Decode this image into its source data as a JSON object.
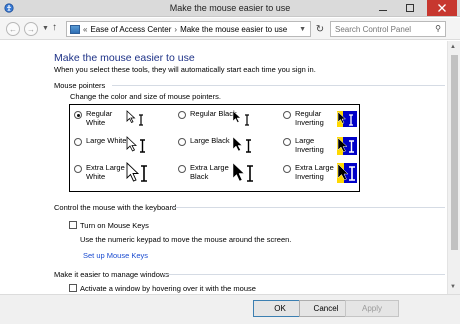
{
  "window": {
    "title": "Make the mouse easier to use"
  },
  "address": {
    "breadcrumbs": [
      "Ease of Access Center",
      "Make the mouse easier to use"
    ],
    "search_placeholder": "Search Control Panel",
    "overflow_glyph": "«"
  },
  "page": {
    "title": "Make the mouse easier to use",
    "description": "When you select these tools, they will automatically start each time you sign in."
  },
  "mouse_pointers": {
    "heading": "Mouse pointers",
    "subheading": "Change the color and size of mouse pointers.",
    "options": [
      {
        "label": "Regular White",
        "style": "white",
        "size": "regular",
        "selected": true
      },
      {
        "label": "Regular Black",
        "style": "black",
        "size": "regular",
        "selected": false
      },
      {
        "label": "Regular Inverting",
        "style": "inverting",
        "size": "regular",
        "selected": false
      },
      {
        "label": "Large White",
        "style": "white",
        "size": "large",
        "selected": false
      },
      {
        "label": "Large Black",
        "style": "black",
        "size": "large",
        "selected": false
      },
      {
        "label": "Large Inverting",
        "style": "inverting",
        "size": "large",
        "selected": false
      },
      {
        "label": "Extra Large White",
        "style": "white",
        "size": "extra-large",
        "selected": false
      },
      {
        "label": "Extra Large Black",
        "style": "black",
        "size": "extra-large",
        "selected": false
      },
      {
        "label": "Extra Large Inverting",
        "style": "inverting",
        "size": "extra-large",
        "selected": false
      }
    ]
  },
  "keyboard": {
    "heading": "Control the mouse with the keyboard",
    "checkbox_label": "Turn on Mouse Keys",
    "checked": false,
    "description": "Use the numeric keypad to move the mouse around the screen.",
    "link": "Set up Mouse Keys"
  },
  "windows": {
    "heading": "Make it easier to manage windows",
    "checkbox_label": "Activate a window by hovering over it with the mouse",
    "checked": false
  },
  "footer": {
    "ok": "OK",
    "cancel": "Cancel",
    "apply": "Apply"
  },
  "colors": {
    "title_blue": "#1e3287",
    "link_blue": "#1a4bd0",
    "inverting_blue": "#0000c8",
    "close_red": "#c7372f"
  }
}
